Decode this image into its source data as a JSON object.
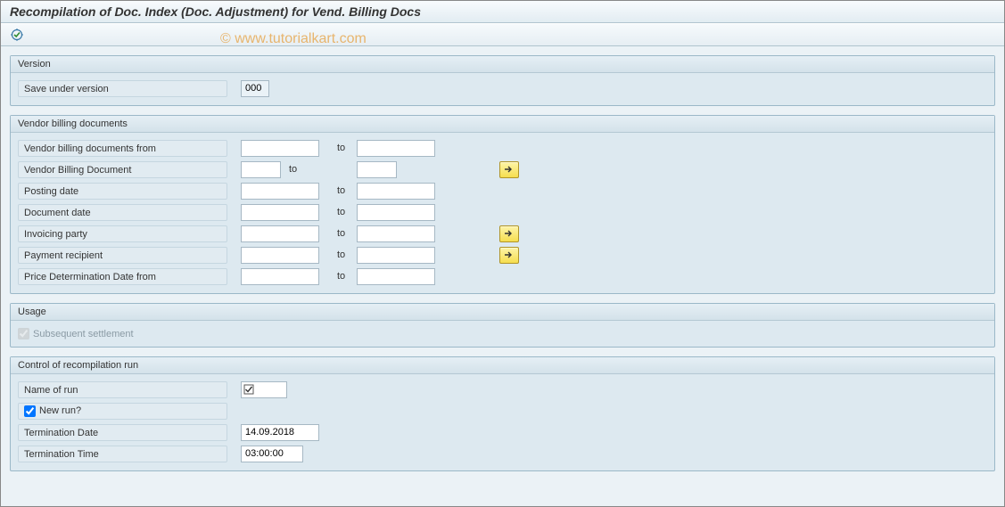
{
  "title": "Recompilation of Doc. Index (Doc. Adjustment) for Vend. Billing Docs",
  "watermark": "© www.tutorialkart.com",
  "toolbar": {
    "execute_icon": "execute"
  },
  "to_label": "to",
  "groups": {
    "version": {
      "title": "Version",
      "save_under": "Save under version",
      "save_under_value": "000"
    },
    "vendor": {
      "title": "Vendor billing documents",
      "rows": {
        "vbd_from": "Vendor billing documents from",
        "vbd": "Vendor Billing Document",
        "posting": "Posting date",
        "docdate": "Document date",
        "invparty": "Invoicing party",
        "payrec": "Payment recipient",
        "pricedet": "Price Determination Date from"
      }
    },
    "usage": {
      "title": "Usage",
      "subseq": "Subsequent settlement"
    },
    "control": {
      "title": "Control of recompilation run",
      "name_of_run": "Name of run",
      "new_run": "New run?",
      "term_date": "Termination Date",
      "term_date_val": "14.09.2018",
      "term_time": "Termination Time",
      "term_time_val": "03:00:00"
    }
  }
}
